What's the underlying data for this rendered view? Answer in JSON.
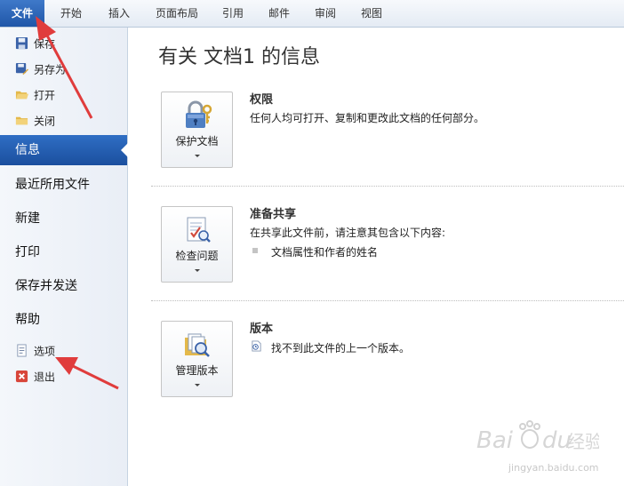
{
  "ribbon": {
    "tabs": [
      {
        "label": "文件",
        "name": "tab-file"
      },
      {
        "label": "开始",
        "name": "tab-home"
      },
      {
        "label": "插入",
        "name": "tab-insert"
      },
      {
        "label": "页面布局",
        "name": "tab-page-layout"
      },
      {
        "label": "引用",
        "name": "tab-references"
      },
      {
        "label": "邮件",
        "name": "tab-mailings"
      },
      {
        "label": "审阅",
        "name": "tab-review"
      },
      {
        "label": "视图",
        "name": "tab-view"
      }
    ]
  },
  "nav": {
    "commands": {
      "save": "保存",
      "save_as": "另存为",
      "open": "打开",
      "close": "关闭",
      "options": "选项",
      "exit": "退出"
    },
    "items": {
      "info": "信息",
      "recent": "最近所用文件",
      "new": "新建",
      "print": "打印",
      "save_send": "保存并发送",
      "help": "帮助"
    }
  },
  "main": {
    "title": "有关 文档1 的信息",
    "permissions": {
      "button": "保护文档",
      "title": "权限",
      "description": "任何人均可打开、复制和更改此文档的任何部分。"
    },
    "prepare": {
      "button": "检查问题",
      "title": "准备共享",
      "description": "在共享此文件前，请注意其包含以下内容:",
      "bullet": "文档属性和作者的姓名"
    },
    "versions": {
      "button": "管理版本",
      "title": "版本",
      "description": "找不到此文件的上一个版本。"
    }
  },
  "watermark": {
    "url": "jingyan.baidu.com"
  },
  "colors": {
    "file_tab": "#1f56a8",
    "active_nav": "#2f6ec4",
    "annotation_arrow": "#e03c3c"
  }
}
